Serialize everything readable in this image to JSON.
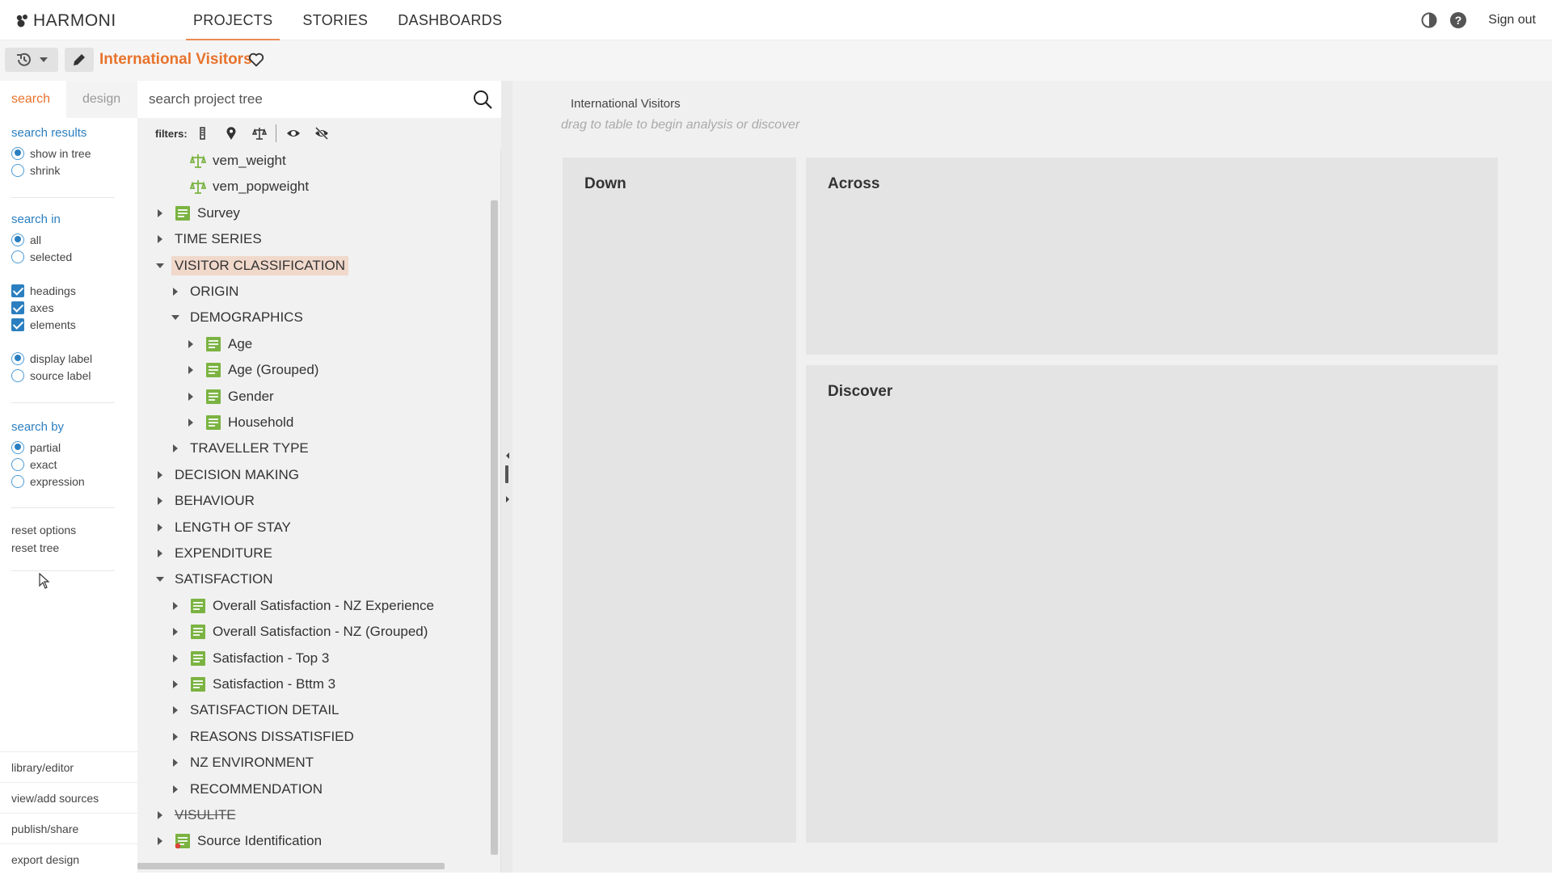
{
  "app": {
    "logo_text": "HARMONI",
    "nav": [
      {
        "label": "PROJECTS",
        "active": true
      },
      {
        "label": "STORIES",
        "active": false
      },
      {
        "label": "DASHBOARDS",
        "active": false
      }
    ],
    "sign_out": "Sign out",
    "icons": {
      "theme": "contrast-icon",
      "help": "help-icon"
    }
  },
  "project": {
    "title": "International Visitors",
    "accent_color": "#e8732c"
  },
  "left_panel": {
    "tabs": [
      {
        "label": "search",
        "active": true
      },
      {
        "label": "design",
        "active": false
      }
    ],
    "search_results": {
      "title": "search results",
      "options": [
        {
          "label": "show in tree",
          "selected": true
        },
        {
          "label": "shrink",
          "selected": false
        }
      ]
    },
    "search_in": {
      "title": "search in",
      "options": [
        {
          "label": "all",
          "selected": true
        },
        {
          "label": "selected",
          "selected": false
        }
      ],
      "checks": [
        {
          "label": "headings",
          "checked": true
        },
        {
          "label": "axes",
          "checked": true
        },
        {
          "label": "elements",
          "checked": true
        }
      ],
      "label_options": [
        {
          "label": "display label",
          "selected": true
        },
        {
          "label": "source label",
          "selected": false
        }
      ]
    },
    "search_by": {
      "title": "search by",
      "options": [
        {
          "label": "partial",
          "selected": true
        },
        {
          "label": "exact",
          "selected": false
        },
        {
          "label": "expression",
          "selected": false
        }
      ]
    },
    "reset_options": "reset options",
    "reset_tree": "reset tree",
    "bottom_links": [
      "library/editor",
      "view/add sources",
      "publish/share",
      "export design"
    ]
  },
  "tree_panel": {
    "search_placeholder": "search project tree",
    "filters_label": "filters:",
    "nodes": [
      {
        "label": "vem_weight",
        "icon": "weight-icon",
        "depth": 1,
        "arrow": "none"
      },
      {
        "label": "vem_popweight",
        "icon": "weight-icon",
        "depth": 1,
        "arrow": "none"
      },
      {
        "label": "Survey",
        "icon": "variable-icon",
        "depth": 0,
        "arrow": "right"
      },
      {
        "label": "TIME SERIES",
        "icon": "",
        "depth": 0,
        "arrow": "right"
      },
      {
        "label": "VISITOR CLASSIFICATION",
        "icon": "",
        "depth": 0,
        "arrow": "down",
        "highlight": true
      },
      {
        "label": "ORIGIN",
        "icon": "",
        "depth": 1,
        "arrow": "right"
      },
      {
        "label": "DEMOGRAPHICS",
        "icon": "",
        "depth": 1,
        "arrow": "down"
      },
      {
        "label": "Age",
        "icon": "variable-icon",
        "depth": 2,
        "arrow": "right"
      },
      {
        "label": "Age (Grouped)",
        "icon": "variable-icon",
        "depth": 2,
        "arrow": "right"
      },
      {
        "label": "Gender",
        "icon": "variable-icon",
        "depth": 2,
        "arrow": "right"
      },
      {
        "label": "Household",
        "icon": "variable-icon",
        "depth": 2,
        "arrow": "right"
      },
      {
        "label": "TRAVELLER TYPE",
        "icon": "",
        "depth": 1,
        "arrow": "right"
      },
      {
        "label": "DECISION MAKING",
        "icon": "",
        "depth": 0,
        "arrow": "right"
      },
      {
        "label": "BEHAVIOUR",
        "icon": "",
        "depth": 0,
        "arrow": "right"
      },
      {
        "label": "LENGTH OF STAY",
        "icon": "",
        "depth": 0,
        "arrow": "right"
      },
      {
        "label": "EXPENDITURE",
        "icon": "",
        "depth": 0,
        "arrow": "right"
      },
      {
        "label": "SATISFACTION",
        "icon": "",
        "depth": 0,
        "arrow": "down"
      },
      {
        "label": "Overall Satisfaction - NZ Experience",
        "icon": "variable-icon",
        "depth": 1,
        "arrow": "right"
      },
      {
        "label": "Overall Satisfaction - NZ (Grouped)",
        "icon": "variable-icon",
        "depth": 1,
        "arrow": "right"
      },
      {
        "label": "Satisfaction - Top 3",
        "icon": "variable-icon",
        "depth": 1,
        "arrow": "right"
      },
      {
        "label": "Satisfaction - Bttm 3",
        "icon": "variable-icon",
        "depth": 1,
        "arrow": "right"
      },
      {
        "label": "SATISFACTION DETAIL",
        "icon": "",
        "depth": 1,
        "arrow": "right"
      },
      {
        "label": "REASONS DISSATISFIED",
        "icon": "",
        "depth": 1,
        "arrow": "right"
      },
      {
        "label": "NZ ENVIRONMENT",
        "icon": "",
        "depth": 1,
        "arrow": "right"
      },
      {
        "label": "RECOMMENDATION",
        "icon": "",
        "depth": 1,
        "arrow": "right"
      },
      {
        "label": "VISULITE",
        "icon": "",
        "depth": 0,
        "arrow": "right",
        "strike": true
      },
      {
        "label": "Source Identification",
        "icon": "source-icon",
        "depth": 0,
        "arrow": "right"
      }
    ]
  },
  "main": {
    "title": "International Visitors",
    "hint": "drag to table to begin analysis or discover",
    "zones": {
      "down": "Down",
      "across": "Across",
      "discover": "Discover"
    }
  }
}
